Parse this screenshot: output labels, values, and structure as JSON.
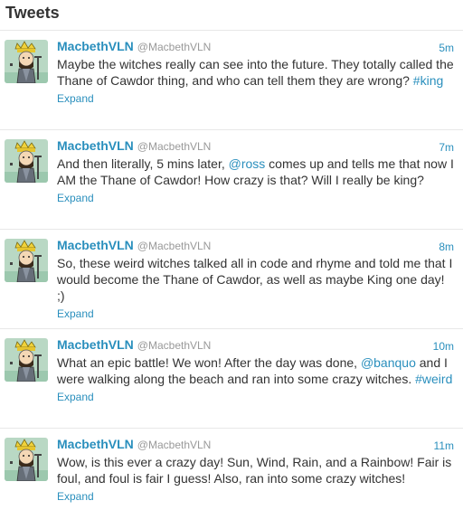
{
  "header": {
    "title": "Tweets"
  },
  "user": {
    "name": "MacbethVLN",
    "handle": "@MacbethVLN"
  },
  "expand_label": "Expand",
  "colors": {
    "link": "#2a8fbd",
    "text": "#333333",
    "muted": "#999999"
  },
  "tweets": [
    {
      "time": "5m",
      "parts": [
        {
          "t": "Maybe the witches really can see into the future. They totally called the Thane of Cawdor thing, and who can tell them they are wrong? "
        },
        {
          "t": "#king",
          "link": true
        }
      ]
    },
    {
      "time": "7m",
      "parts": [
        {
          "t": "And then literally, 5 mins later, "
        },
        {
          "t": "@ross",
          "link": true
        },
        {
          "t": " comes up and tells me that now I AM the Thane of Cawdor! How crazy is that? Will I really be king?"
        }
      ]
    },
    {
      "time": "8m",
      "parts": [
        {
          "t": "So, these weird witches talked all in code and rhyme and told me that I would become the Thane of Cawdor, as well as maybe King one day! ;)"
        }
      ]
    },
    {
      "time": "10m",
      "parts": [
        {
          "t": "What an epic battle! We won! After the day was done, "
        },
        {
          "t": "@banquo",
          "link": true
        },
        {
          "t": " and I were walking along the beach and ran into some crazy witches. "
        },
        {
          "t": "#weird",
          "link": true
        }
      ]
    },
    {
      "time": "11m",
      "parts": [
        {
          "t": "Wow, is this ever a crazy day! Sun, Wind, Rain, and a Rainbow! Fair is foul, and foul is fair I guess! Also, ran into some crazy witches!"
        }
      ]
    }
  ]
}
